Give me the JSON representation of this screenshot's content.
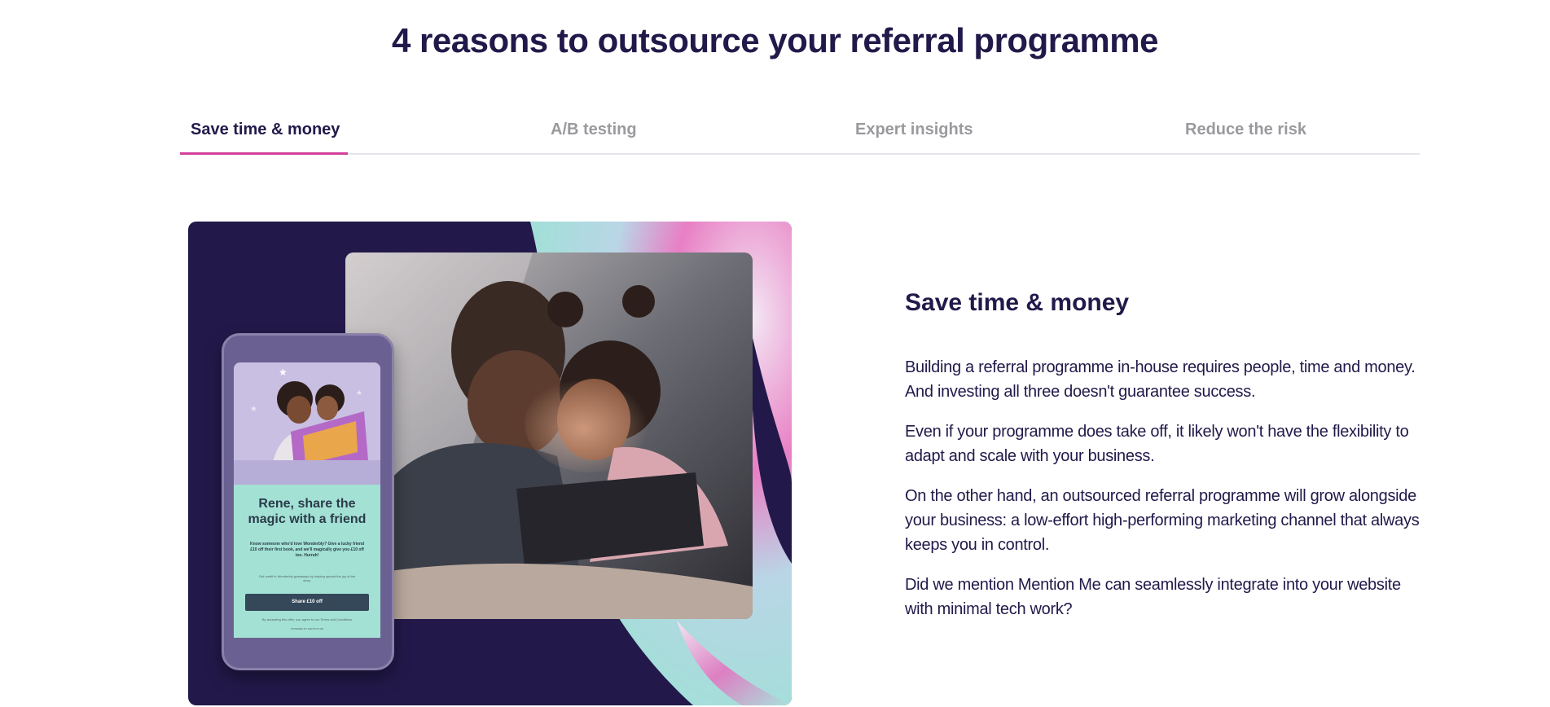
{
  "page": {
    "heading": "4 reasons to outsource your referral programme"
  },
  "tabs": [
    {
      "label": "Save time & money",
      "active": true
    },
    {
      "label": "A/B testing",
      "active": false
    },
    {
      "label": "Expert insights",
      "active": false
    },
    {
      "label": "Reduce the risk",
      "active": false
    }
  ],
  "content": {
    "title": "Save time & money",
    "paragraphs": [
      "Building a referral programme in-house requires people, time and money. And investing all three doesn't guarantee success.",
      "Even if your programme does take off, it likely won't have the flexibility to adapt and scale with your business.",
      "On the other hand, an outsourced referral programme will grow alongside your business: a low-effort high-performing marketing channel that always keeps you in control.",
      "Did we mention Mention Me can seamlessly integrate into your website with minimal tech work?"
    ]
  },
  "phone_mockup": {
    "title": "Rene, share the magic with a friend",
    "body": "Know someone who'd love Wonderbly? Give a lucky friend £10 off their first book, and we'll magically give you £10 off too. Hurrah!",
    "fine_print": "Get credit in Wonderbly giveaways by helping spread the joy of the story.",
    "button": "Share £10 off",
    "legal": "By accepting this offer, you agree to our Terms and Conditions",
    "powered": "POWERED BY MENTION ME"
  },
  "colors": {
    "navy": "#22194a",
    "accent_pink": "#d2409a",
    "muted_tab": "#9a9a9e",
    "mint": "#a3e1d4"
  }
}
